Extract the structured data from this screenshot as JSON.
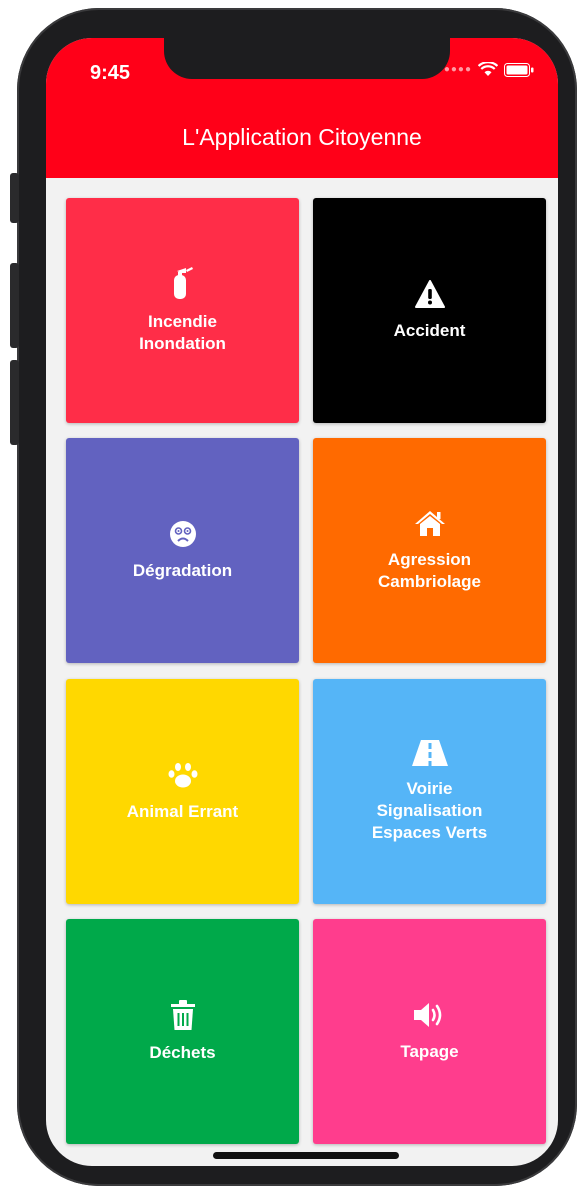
{
  "status_bar": {
    "time": "9:45"
  },
  "header": {
    "title": "L'Application Citoyenne",
    "color": "#ff0018"
  },
  "tiles": [
    {
      "label": "Incendie\nInondation",
      "icon": "fire-extinguisher-icon",
      "color": "#ff2d48"
    },
    {
      "label": "Accident",
      "icon": "warning-icon",
      "color": "#000000"
    },
    {
      "label": "Dégradation",
      "icon": "sad-face-icon",
      "color": "#6262c0"
    },
    {
      "label": "Agression\nCambriolage",
      "icon": "home-icon",
      "color": "#ff6a00"
    },
    {
      "label": "Animal Errant",
      "icon": "paw-icon",
      "color": "#ffd800"
    },
    {
      "label": "Voirie\nSignalisation\nEspaces Verts",
      "icon": "road-icon",
      "color": "#55b5f7"
    },
    {
      "label": "Déchets",
      "icon": "trash-icon",
      "color": "#00a94a"
    },
    {
      "label": "Tapage",
      "icon": "volume-icon",
      "color": "#ff3d8d"
    }
  ]
}
